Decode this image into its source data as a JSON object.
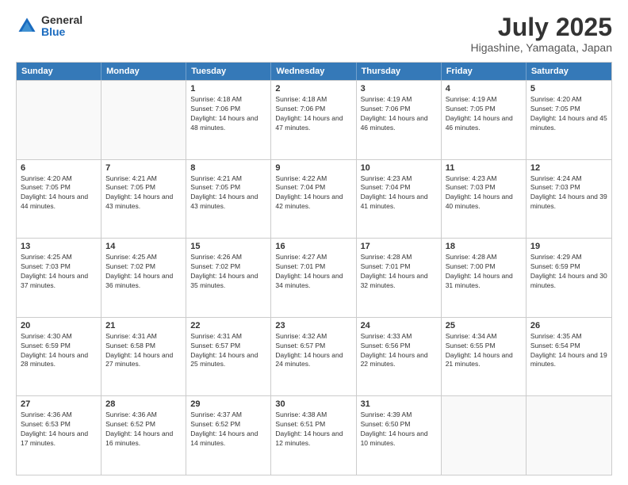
{
  "logo": {
    "general": "General",
    "blue": "Blue"
  },
  "header": {
    "month_year": "July 2025",
    "location": "Higashine, Yamagata, Japan"
  },
  "weekdays": [
    "Sunday",
    "Monday",
    "Tuesday",
    "Wednesday",
    "Thursday",
    "Friday",
    "Saturday"
  ],
  "weeks": [
    [
      {
        "day": "",
        "empty": true
      },
      {
        "day": "",
        "empty": true
      },
      {
        "day": "1",
        "sunrise": "Sunrise: 4:18 AM",
        "sunset": "Sunset: 7:06 PM",
        "daylight": "Daylight: 14 hours and 48 minutes."
      },
      {
        "day": "2",
        "sunrise": "Sunrise: 4:18 AM",
        "sunset": "Sunset: 7:06 PM",
        "daylight": "Daylight: 14 hours and 47 minutes."
      },
      {
        "day": "3",
        "sunrise": "Sunrise: 4:19 AM",
        "sunset": "Sunset: 7:06 PM",
        "daylight": "Daylight: 14 hours and 46 minutes."
      },
      {
        "day": "4",
        "sunrise": "Sunrise: 4:19 AM",
        "sunset": "Sunset: 7:05 PM",
        "daylight": "Daylight: 14 hours and 46 minutes."
      },
      {
        "day": "5",
        "sunrise": "Sunrise: 4:20 AM",
        "sunset": "Sunset: 7:05 PM",
        "daylight": "Daylight: 14 hours and 45 minutes."
      }
    ],
    [
      {
        "day": "6",
        "sunrise": "Sunrise: 4:20 AM",
        "sunset": "Sunset: 7:05 PM",
        "daylight": "Daylight: 14 hours and 44 minutes."
      },
      {
        "day": "7",
        "sunrise": "Sunrise: 4:21 AM",
        "sunset": "Sunset: 7:05 PM",
        "daylight": "Daylight: 14 hours and 43 minutes."
      },
      {
        "day": "8",
        "sunrise": "Sunrise: 4:21 AM",
        "sunset": "Sunset: 7:05 PM",
        "daylight": "Daylight: 14 hours and 43 minutes."
      },
      {
        "day": "9",
        "sunrise": "Sunrise: 4:22 AM",
        "sunset": "Sunset: 7:04 PM",
        "daylight": "Daylight: 14 hours and 42 minutes."
      },
      {
        "day": "10",
        "sunrise": "Sunrise: 4:23 AM",
        "sunset": "Sunset: 7:04 PM",
        "daylight": "Daylight: 14 hours and 41 minutes."
      },
      {
        "day": "11",
        "sunrise": "Sunrise: 4:23 AM",
        "sunset": "Sunset: 7:03 PM",
        "daylight": "Daylight: 14 hours and 40 minutes."
      },
      {
        "day": "12",
        "sunrise": "Sunrise: 4:24 AM",
        "sunset": "Sunset: 7:03 PM",
        "daylight": "Daylight: 14 hours and 39 minutes."
      }
    ],
    [
      {
        "day": "13",
        "sunrise": "Sunrise: 4:25 AM",
        "sunset": "Sunset: 7:03 PM",
        "daylight": "Daylight: 14 hours and 37 minutes."
      },
      {
        "day": "14",
        "sunrise": "Sunrise: 4:25 AM",
        "sunset": "Sunset: 7:02 PM",
        "daylight": "Daylight: 14 hours and 36 minutes."
      },
      {
        "day": "15",
        "sunrise": "Sunrise: 4:26 AM",
        "sunset": "Sunset: 7:02 PM",
        "daylight": "Daylight: 14 hours and 35 minutes."
      },
      {
        "day": "16",
        "sunrise": "Sunrise: 4:27 AM",
        "sunset": "Sunset: 7:01 PM",
        "daylight": "Daylight: 14 hours and 34 minutes."
      },
      {
        "day": "17",
        "sunrise": "Sunrise: 4:28 AM",
        "sunset": "Sunset: 7:01 PM",
        "daylight": "Daylight: 14 hours and 32 minutes."
      },
      {
        "day": "18",
        "sunrise": "Sunrise: 4:28 AM",
        "sunset": "Sunset: 7:00 PM",
        "daylight": "Daylight: 14 hours and 31 minutes."
      },
      {
        "day": "19",
        "sunrise": "Sunrise: 4:29 AM",
        "sunset": "Sunset: 6:59 PM",
        "daylight": "Daylight: 14 hours and 30 minutes."
      }
    ],
    [
      {
        "day": "20",
        "sunrise": "Sunrise: 4:30 AM",
        "sunset": "Sunset: 6:59 PM",
        "daylight": "Daylight: 14 hours and 28 minutes."
      },
      {
        "day": "21",
        "sunrise": "Sunrise: 4:31 AM",
        "sunset": "Sunset: 6:58 PM",
        "daylight": "Daylight: 14 hours and 27 minutes."
      },
      {
        "day": "22",
        "sunrise": "Sunrise: 4:31 AM",
        "sunset": "Sunset: 6:57 PM",
        "daylight": "Daylight: 14 hours and 25 minutes."
      },
      {
        "day": "23",
        "sunrise": "Sunrise: 4:32 AM",
        "sunset": "Sunset: 6:57 PM",
        "daylight": "Daylight: 14 hours and 24 minutes."
      },
      {
        "day": "24",
        "sunrise": "Sunrise: 4:33 AM",
        "sunset": "Sunset: 6:56 PM",
        "daylight": "Daylight: 14 hours and 22 minutes."
      },
      {
        "day": "25",
        "sunrise": "Sunrise: 4:34 AM",
        "sunset": "Sunset: 6:55 PM",
        "daylight": "Daylight: 14 hours and 21 minutes."
      },
      {
        "day": "26",
        "sunrise": "Sunrise: 4:35 AM",
        "sunset": "Sunset: 6:54 PM",
        "daylight": "Daylight: 14 hours and 19 minutes."
      }
    ],
    [
      {
        "day": "27",
        "sunrise": "Sunrise: 4:36 AM",
        "sunset": "Sunset: 6:53 PM",
        "daylight": "Daylight: 14 hours and 17 minutes."
      },
      {
        "day": "28",
        "sunrise": "Sunrise: 4:36 AM",
        "sunset": "Sunset: 6:52 PM",
        "daylight": "Daylight: 14 hours and 16 minutes."
      },
      {
        "day": "29",
        "sunrise": "Sunrise: 4:37 AM",
        "sunset": "Sunset: 6:52 PM",
        "daylight": "Daylight: 14 hours and 14 minutes."
      },
      {
        "day": "30",
        "sunrise": "Sunrise: 4:38 AM",
        "sunset": "Sunset: 6:51 PM",
        "daylight": "Daylight: 14 hours and 12 minutes."
      },
      {
        "day": "31",
        "sunrise": "Sunrise: 4:39 AM",
        "sunset": "Sunset: 6:50 PM",
        "daylight": "Daylight: 14 hours and 10 minutes."
      },
      {
        "day": "",
        "empty": true
      },
      {
        "day": "",
        "empty": true
      }
    ]
  ]
}
